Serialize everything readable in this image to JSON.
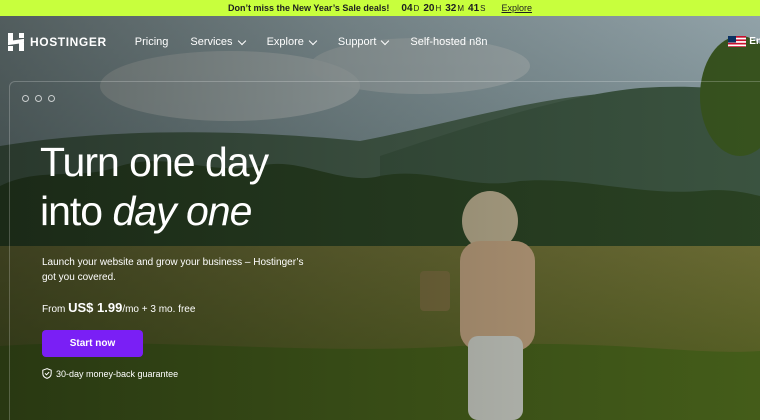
{
  "promo": {
    "message": "Don’t miss the New Year’s Sale deals!",
    "countdown": [
      {
        "value": "04",
        "unit": "D"
      },
      {
        "value": "20",
        "unit": "H"
      },
      {
        "value": "32",
        "unit": "M"
      },
      {
        "value": "41",
        "unit": "S"
      }
    ],
    "link": "Explore",
    "background": "#c8ff3d"
  },
  "nav": {
    "logo": "HOSTINGER",
    "items": [
      {
        "label": "Pricing",
        "dropdown": false
      },
      {
        "label": "Services",
        "dropdown": true
      },
      {
        "label": "Explore",
        "dropdown": true
      },
      {
        "label": "Support",
        "dropdown": true
      },
      {
        "label": "Self-hosted n8n",
        "dropdown": false
      }
    ],
    "language": "En"
  },
  "hero": {
    "headline_line1": "Turn one day",
    "headline_line2_plain": "into ",
    "headline_line2_italic": "day one",
    "subtitle": "Launch your website and grow your business – Hostinger’s got you covered.",
    "price_prefix": "From ",
    "price_amount": "US$ 1.99",
    "price_suffix": "/mo + 3 mo. free",
    "cta": "Start now",
    "guarantee": "30-day money-back guarantee"
  },
  "colors": {
    "cta": "#7a1ff5",
    "accent": "#c8ff3d"
  },
  "icons": [
    "hostinger-logo",
    "chevron-down-icon",
    "us-flag-icon",
    "shield-icon"
  ]
}
